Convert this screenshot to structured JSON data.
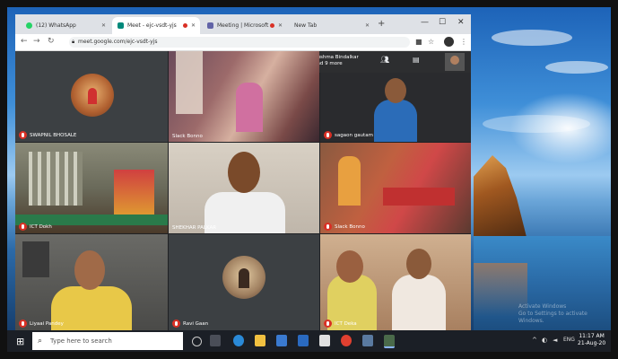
{
  "browser": {
    "tabs": [
      {
        "label": "(12) WhatsApp",
        "icon": "whatsapp-icon",
        "color": "#25d366"
      },
      {
        "label": "Meet - ejc-vsdt-yjs",
        "icon": "meet-icon",
        "color": "#00897b"
      },
      {
        "label": "Meeting | Microsoft",
        "icon": "teams-icon",
        "color": "#6264a7"
      },
      {
        "label": "New Tab",
        "icon": "new-tab-icon",
        "color": ""
      }
    ],
    "url": "meet.google.com/ejc-vsdt-yjs"
  },
  "meet": {
    "participants_panel": {
      "line1": "Sushma Bindalkar",
      "line2": "and 9 more"
    },
    "tiles": [
      {
        "name": "SWAPNIL BHOSALE",
        "kind": "avatar",
        "muted": true
      },
      {
        "name": "Slack Bonno",
        "kind": "video",
        "muted": false
      },
      {
        "name": "sagaon gautam",
        "kind": "video",
        "muted": true
      },
      {
        "name": "ICT Dokh",
        "kind": "video",
        "muted": true
      },
      {
        "name": "SHEKHAR PALKAR",
        "kind": "video",
        "muted": false
      },
      {
        "name": "Slack Bonno",
        "kind": "video",
        "muted": true
      },
      {
        "name": "Liyaai Pandey",
        "kind": "video",
        "muted": true
      },
      {
        "name": "Ravi Gaan",
        "kind": "avatar",
        "muted": true
      },
      {
        "name": "ICT Deka",
        "kind": "video",
        "muted": true
      }
    ]
  },
  "desktop": {
    "watermark_line1": "Activate Windows",
    "watermark_line2": "Go to Settings to activate Windows."
  },
  "taskbar": {
    "search_placeholder": "Type here to search",
    "time": "11:17 AM",
    "date": "21-Aug-20",
    "lang": "ENG"
  }
}
